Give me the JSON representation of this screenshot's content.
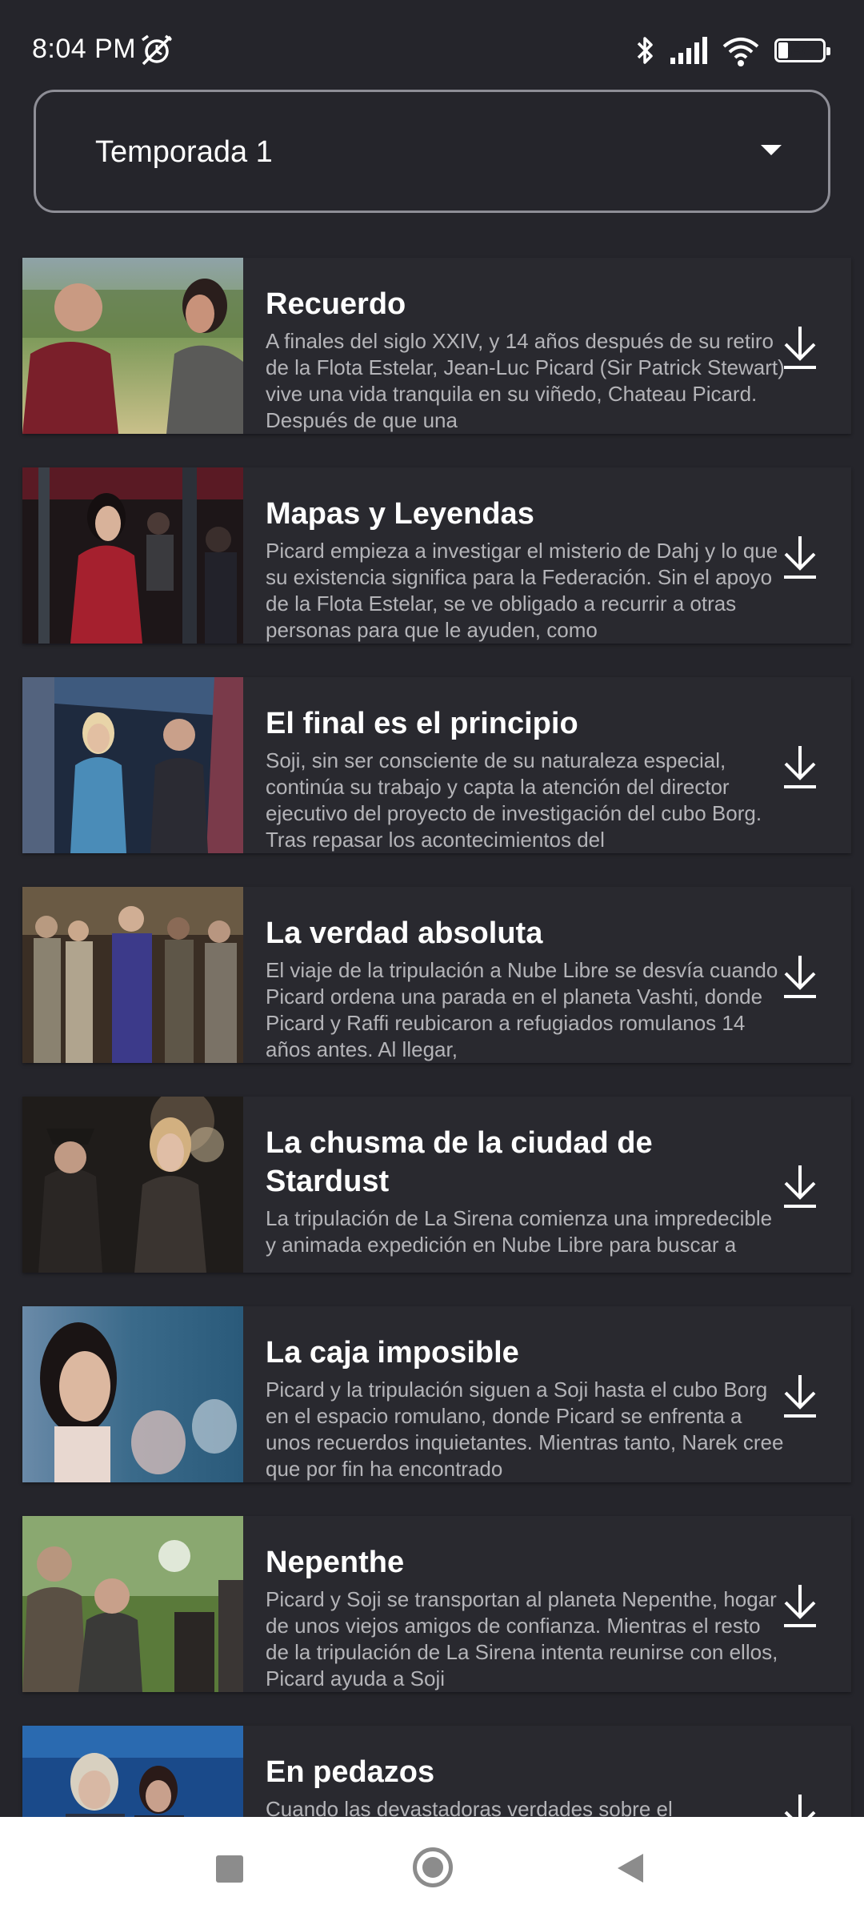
{
  "status_bar": {
    "time": "8:04 PM",
    "battery_level": "27",
    "icons": [
      "alarm-off-icon",
      "bluetooth-icon",
      "signal-icon",
      "wifi-icon",
      "battery-icon"
    ]
  },
  "season_selector": {
    "selected": "Temporada 1",
    "icon": "dropdown-caret-icon"
  },
  "episodes": [
    {
      "title": "Recuerdo",
      "description": "A finales del siglo XXIV, y 14 años después de su retiro de la Flota Estelar, Jean-Luc Picard (Sir Patrick Stewart) vive una vida tranquila en su viñedo, Chateau Picard. Después de que una",
      "icon": "download-icon"
    },
    {
      "title": "Mapas y Leyendas",
      "description": "Picard empieza a investigar el misterio de Dahj y lo que su existencia significa para la Federación. Sin el apoyo de la Flota Estelar, se ve obligado a recurrir a otras personas para que le ayuden, como",
      "icon": "download-icon"
    },
    {
      "title": "El final es el principio",
      "description": "Soji, sin ser consciente de su naturaleza especial, continúa su trabajo y capta la atención del director ejecutivo del proyecto de investigación del cubo Borg. Tras repasar los acontecimientos del",
      "icon": "download-icon"
    },
    {
      "title": "La verdad absoluta",
      "description": "El viaje de la tripulación a Nube Libre se desvía cuando Picard ordena una parada en el planeta Vashti, donde Picard y Raffi reubicaron a refugiados romulanos 14 años antes. Al llegar,",
      "icon": "download-icon"
    },
    {
      "title": "La chusma de la ciudad de Stardust",
      "description": "La tripulación de La Sirena comienza una impredecible y animada expedición en Nube Libre para buscar a Bruce Maddox. Cuando averiguan",
      "icon": "download-icon"
    },
    {
      "title": "La caja imposible",
      "description": "Picard y la tripulación siguen a Soji hasta el cubo Borg en el espacio romulano, donde Picard se enfrenta a unos recuerdos inquietantes. Mientras tanto, Narek cree que por fin ha encontrado",
      "icon": "download-icon"
    },
    {
      "title": "Nepenthe",
      "description": "Picard y Soji se transportan al planeta Nepenthe, hogar de unos viejos amigos de confianza. Mientras el resto de la tripulación de La Sirena intenta reunirse con ellos, Picard ayuda a Soji",
      "icon": "download-icon"
    },
    {
      "title": "En pedazos",
      "description": "Cuando las devastadoras verdades sobre el",
      "icon": "download-icon"
    }
  ],
  "nav_bar": {
    "icons": [
      "recent-apps-icon",
      "home-icon",
      "back-icon"
    ]
  },
  "colors": {
    "background": "#25252b",
    "card": "#29292f",
    "title": "#ffffff",
    "description": "#b4b4b8",
    "nav_bar": "#ffffff"
  }
}
